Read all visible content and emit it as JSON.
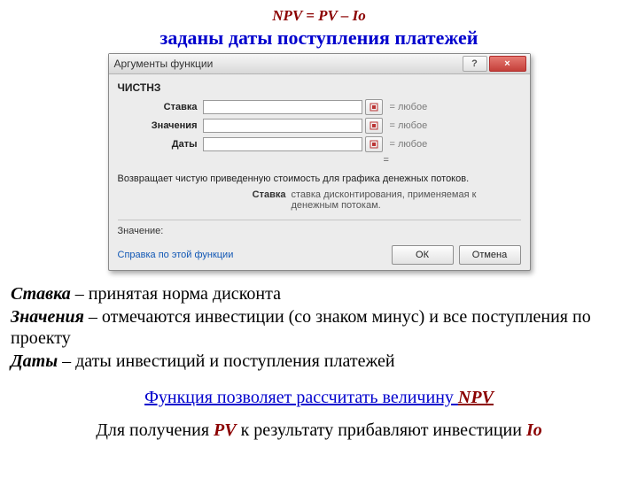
{
  "formula": "NPV = PV – Io",
  "subtitle": "заданы даты поступления платежей",
  "dialog": {
    "title": "Аргументы функции",
    "help_btn": "?",
    "close_btn": "×",
    "func_name": "ЧИСТНЗ",
    "args": [
      {
        "label": "Ставка",
        "hint": "= любое"
      },
      {
        "label": "Значения",
        "hint": "= любое"
      },
      {
        "label": "Даты",
        "hint": "= любое"
      }
    ],
    "result_eq": "=",
    "description": "Возвращает чистую приведенную стоимость для графика денежных потоков.",
    "arg_help": {
      "label": "Ставка",
      "text": "ставка дисконтирования, применяемая к денежным потокам."
    },
    "value_label": "Значение:",
    "help_link": "Справка по этой функции",
    "ok": "ОК",
    "cancel": "Отмена"
  },
  "explain": {
    "p1_term": "Ставка",
    "p1_rest": " – принятая норма дисконта",
    "p2_term": "Значения",
    "p2_rest": " – отмечаются инвестиции (со знаком минус) и все поступления по проекту",
    "p3_term": "Даты",
    "p3_rest": " – даты инвестиций и поступления платежей"
  },
  "note1": {
    "text_before": "Функция позволяет рассчитать величину ",
    "npv": "NPV"
  },
  "note2": {
    "a": "Для получения ",
    "pv": "PV",
    "b": " к результату прибавляют инвестиции ",
    "io": "Io"
  }
}
